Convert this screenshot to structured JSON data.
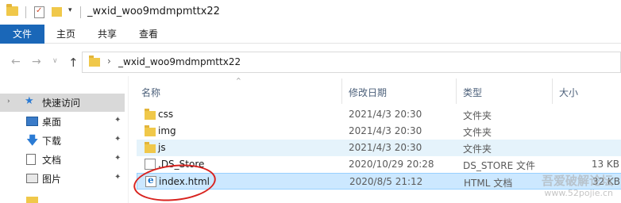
{
  "window": {
    "title": "_wxid_woo9mdmpmttx22",
    "quick_access_dropdown": "▾"
  },
  "ribbon": {
    "tabs": [
      "文件",
      "主页",
      "共享",
      "查看"
    ]
  },
  "address": {
    "back": "←",
    "forward": "→",
    "recent": "∨",
    "up": "↑",
    "path_separator": "›",
    "path": "_wxid_woo9mdmpmttx22"
  },
  "navpane": {
    "items": [
      {
        "label": "快速访问",
        "icon": "star-icon",
        "arrow": "›"
      },
      {
        "label": "桌面",
        "icon": "desktop-icon",
        "pin": "📌"
      },
      {
        "label": "下载",
        "icon": "download-icon",
        "pin": "📌"
      },
      {
        "label": "文档",
        "icon": "document-icon",
        "pin": "📌"
      },
      {
        "label": "图片",
        "icon": "picture-icon",
        "pin": "📌"
      }
    ]
  },
  "columns": {
    "name": "名称",
    "modified": "修改日期",
    "type": "类型",
    "size": "大小",
    "sort_indicator": "^"
  },
  "files": [
    {
      "name": "css",
      "modified": "2021/4/3 20:30",
      "type": "文件夹",
      "size": "",
      "icon": "folder-icon"
    },
    {
      "name": "img",
      "modified": "2021/4/3 20:30",
      "type": "文件夹",
      "size": "",
      "icon": "folder-icon"
    },
    {
      "name": "js",
      "modified": "2021/4/3 20:30",
      "type": "文件夹",
      "size": "",
      "icon": "folder-icon"
    },
    {
      "name": ".DS_Store",
      "modified": "2020/10/29 20:28",
      "type": "DS_STORE 文件",
      "size": "13 KB",
      "icon": "file-icon"
    },
    {
      "name": "index.html",
      "modified": "2020/8/5 21:12",
      "type": "HTML 文档",
      "size": "32 KB",
      "icon": "html-file-icon"
    }
  ],
  "watermark": {
    "line1": "吾爱破解论坛",
    "line2": "www.52pojie.cn"
  },
  "colors": {
    "accent": "#1a67b8",
    "selection": "#cce8ff",
    "hover": "#e5f3fb",
    "annotation": "#d8231f"
  }
}
